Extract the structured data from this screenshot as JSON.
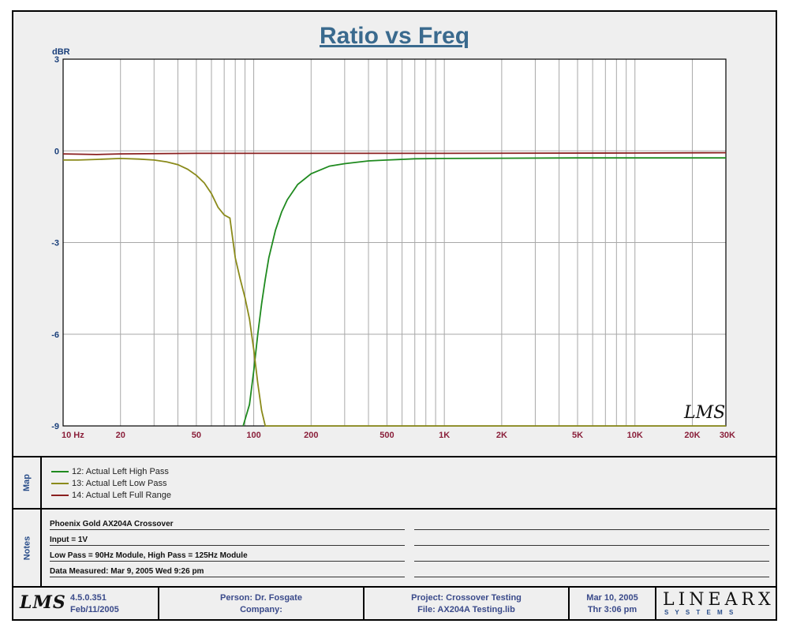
{
  "chart_data": {
    "type": "line",
    "title": "Ratio vs Freq",
    "ylabel": "dBR",
    "xlabel": "",
    "x_scale": "log",
    "xlim": [
      10,
      30000
    ],
    "ylim": [
      -9,
      3
    ],
    "grid": true,
    "y_ticks": [
      "3",
      "0",
      "-3",
      "-6",
      "-9"
    ],
    "x_ticks": [
      {
        "value": 10,
        "label": "10  Hz"
      },
      {
        "value": 20,
        "label": "20"
      },
      {
        "value": 50,
        "label": "50"
      },
      {
        "value": 100,
        "label": "100"
      },
      {
        "value": 200,
        "label": "200"
      },
      {
        "value": 500,
        "label": "500"
      },
      {
        "value": 1000,
        "label": "1K"
      },
      {
        "value": 2000,
        "label": "2K"
      },
      {
        "value": 5000,
        "label": "5K"
      },
      {
        "value": 10000,
        "label": "10K"
      },
      {
        "value": 20000,
        "label": "20K"
      },
      {
        "value": 30000,
        "label": "30K"
      }
    ],
    "series": [
      {
        "name": "12: Actual Left High Pass",
        "color": "#1f8a1f",
        "x": [
          88,
          95,
          100,
          105,
          110,
          115,
          120,
          130,
          140,
          150,
          170,
          200,
          250,
          300,
          400,
          500,
          700,
          1000,
          2000,
          5000,
          10000,
          20000,
          30000
        ],
        "y": [
          -9.0,
          -8.3,
          -7.2,
          -6.0,
          -5.0,
          -4.2,
          -3.5,
          -2.6,
          -2.0,
          -1.6,
          -1.1,
          -0.75,
          -0.5,
          -0.42,
          -0.33,
          -0.3,
          -0.26,
          -0.25,
          -0.24,
          -0.23,
          -0.23,
          -0.23,
          -0.23
        ]
      },
      {
        "name": "13: Actual Left Low Pass",
        "color": "#8a8a1a",
        "x": [
          10,
          12,
          15,
          20,
          25,
          30,
          35,
          40,
          45,
          50,
          55,
          60,
          65,
          70,
          75,
          80,
          85,
          90,
          95,
          100,
          105,
          110,
          115,
          130,
          200,
          1000,
          30000
        ],
        "y": [
          -0.3,
          -0.3,
          -0.28,
          -0.25,
          -0.27,
          -0.3,
          -0.36,
          -0.45,
          -0.6,
          -0.8,
          -1.05,
          -1.4,
          -1.85,
          -2.1,
          -2.2,
          -3.5,
          -4.2,
          -4.8,
          -5.5,
          -6.5,
          -7.6,
          -8.5,
          -9.0,
          -9.0,
          -9.0,
          -9.0,
          -9.0
        ]
      },
      {
        "name": "14: Actual Left Full Range",
        "color": "#8a1f1f",
        "x": [
          10,
          15,
          20,
          50,
          100,
          1000,
          10000,
          30000
        ],
        "y": [
          -0.1,
          -0.12,
          -0.1,
          -0.08,
          -0.08,
          -0.08,
          -0.07,
          -0.06
        ]
      }
    ]
  },
  "watermark": "LMS",
  "notes": {
    "label": "Notes",
    "lines": [
      "Phoenix Gold AX204A Crossover",
      "Input = 1V",
      "Low Pass = 90Hz Module, High Pass = 125Hz Module",
      "Data Measured: Mar 9, 2005  Wed  9:26 pm"
    ]
  },
  "map_label": "Map",
  "footer": {
    "logo": "LMS",
    "version": "4.5.0.351",
    "version_date": "Feb/11/2005",
    "person": "Person: Dr. Fosgate",
    "company": "Company:",
    "project": "Project: Crossover Testing",
    "file": "File: AX204A Testing.lib",
    "date": "Mar 10, 2005",
    "time": "Thr  3:06 pm",
    "brand": "LINEARX",
    "brand_sub": "S Y S T E M S"
  }
}
